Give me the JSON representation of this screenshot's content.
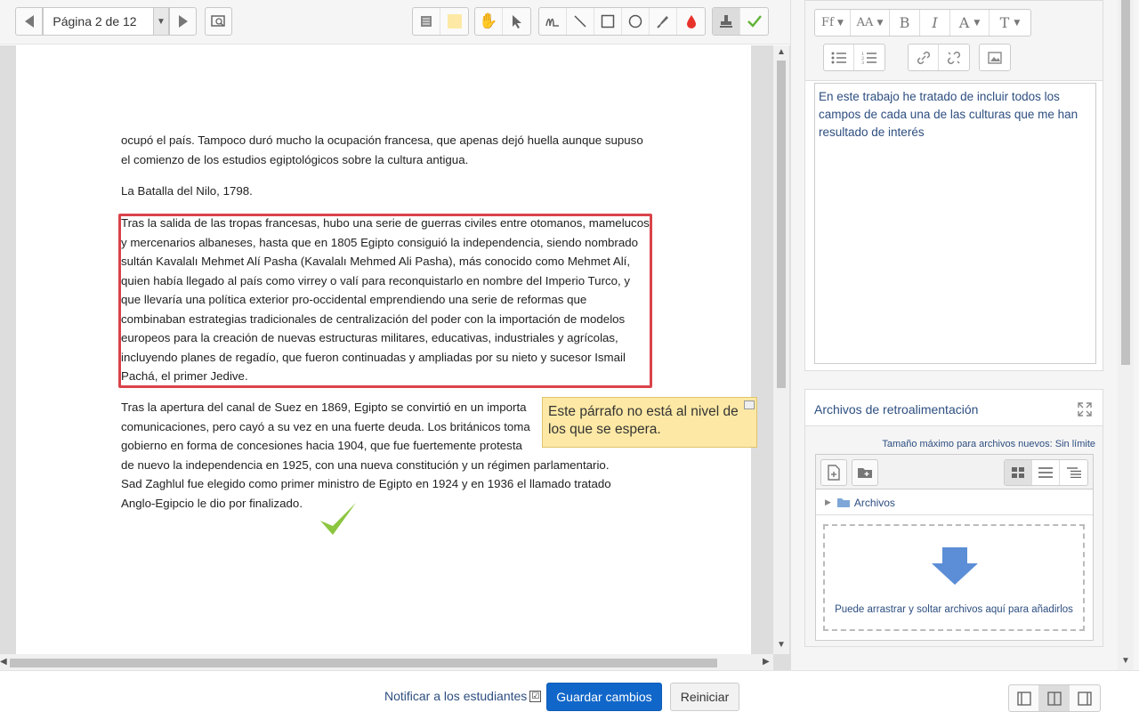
{
  "toolbar": {
    "page_select": "Página 2 de 12"
  },
  "document": {
    "para1": "ocupó el país. Tampoco duró mucho la ocupación francesa, que apenas dejó huella aunque supuso el comienzo de los estudios egiptológicos sobre la cultura antigua.",
    "para2": "La Batalla del Nilo, 1798.",
    "para3": "Tras la salida de las tropas francesas, hubo una serie de guerras civiles entre otomanos, mamelucos y mercenarios albaneses, hasta que en 1805 Egipto consiguió la independencia, siendo nombrado sultán Kavalalı Mehmet Alí Pasha (Kavalalı Mehmed Ali Pasha), más conocido como Mehmet Alí, quien había llegado al país como virrey o valí para reconquistarlo en nombre del Imperio Turco, y que llevaría una política exterior pro-occidental emprendiendo una serie de reformas que combinaban estrategias tradicionales de centralización del poder con la importación de modelos europeos para la creación de nuevas estructuras militares, educativas, industriales y agrícolas, incluyendo planes de regadío, que fueron continuadas y ampliadas por su nieto y sucesor Ismail Pachá, el primer Jedive.",
    "para4_lines": [
      "Tras la apertura del canal de Suez en 1869, Egipto se convirtió en un importa",
      "comunicaciones, pero cayó a su vez en una fuerte deuda. Los británicos toma",
      "gobierno en forma de concesiones hacia 1904, que fue fuertemente protesta",
      "de nuevo la independencia en 1925, con una nueva constitución y un régimen parlamentario.",
      "Sad Zaghlul fue elegido como primer ministro de Egipto en 1924 y en 1936 el llamado tratado",
      "Anglo-Egipcio le dio por finalizado."
    ],
    "comment": "Este párrafo no está al nivel de los que se espera."
  },
  "editor": {
    "font_btn": "Ff",
    "size_btn": "AA",
    "bold_btn": "B",
    "italic_btn": "I",
    "color_btn": "A",
    "style_btn": "T",
    "text": "En este trabajo he tratado de incluir todos los campos de cada una de las culturas que me han resultado de interés"
  },
  "feedback_files": {
    "title": "Archivos de retroalimentación",
    "max_size": "Tamaño máximo para archivos nuevos: Sin límite",
    "folder": "Archivos",
    "drop_text": "Puede arrastrar y soltar archivos aquí para añadirlos"
  },
  "bottom": {
    "notify_label": "Notificar a los estudiantes",
    "notify_checked": "☑",
    "save_label": "Guardar cambios",
    "reset_label": "Reiniciar"
  },
  "colors": {
    "highlight": "#d9434a",
    "comment_bg": "#fde9a5",
    "check_green": "#8cc63f",
    "primary": "#1167c9",
    "link": "#2d4e80"
  }
}
